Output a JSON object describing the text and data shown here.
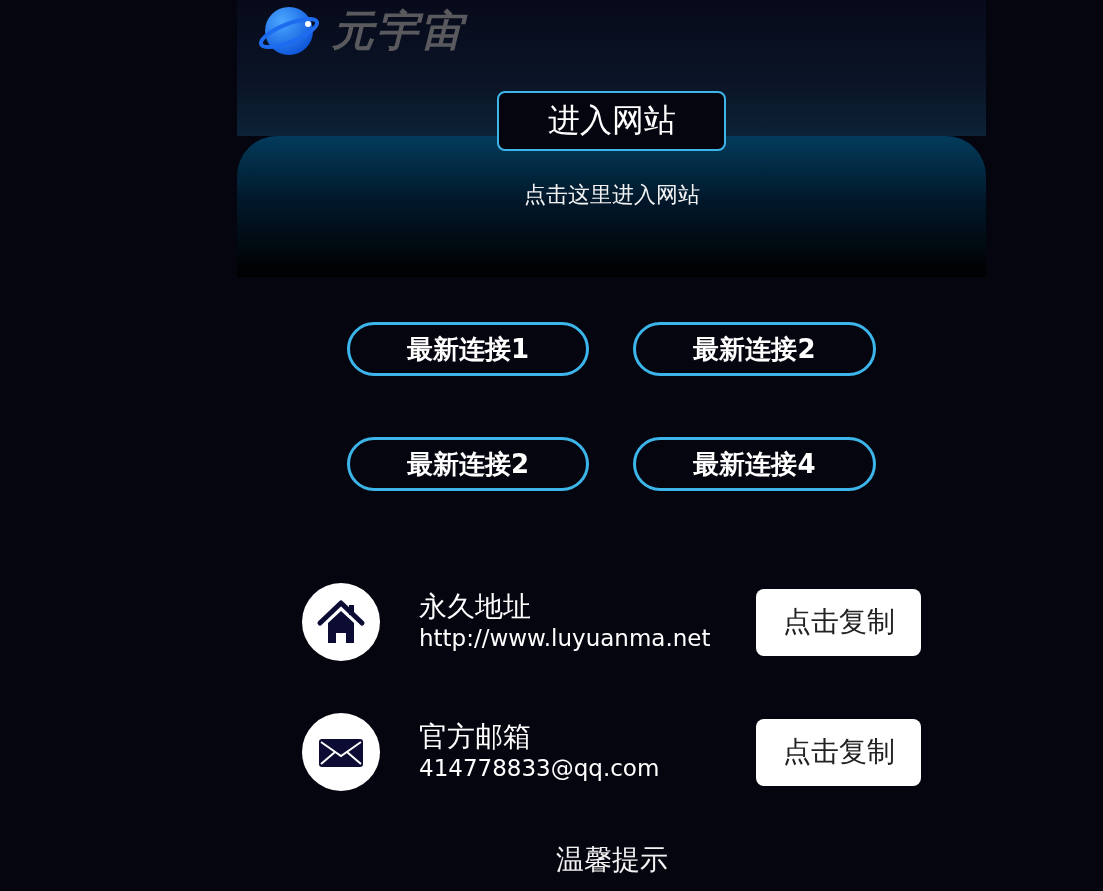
{
  "header": {
    "logo_text": "元宇宙",
    "enter_button": "进入网站",
    "hint": "点击这里进入网站"
  },
  "links": [
    "最新连接1",
    "最新连接2",
    "最新连接2",
    "最新连接4"
  ],
  "contacts": [
    {
      "kind": "home",
      "label": "永久地址",
      "value": "http://www.luyuanma.net",
      "button": "点击复制"
    },
    {
      "kind": "mail",
      "label": "官方邮箱",
      "value": "414778833@qq.com",
      "button": "点击复制"
    }
  ],
  "notice": {
    "title": "温馨提示"
  }
}
